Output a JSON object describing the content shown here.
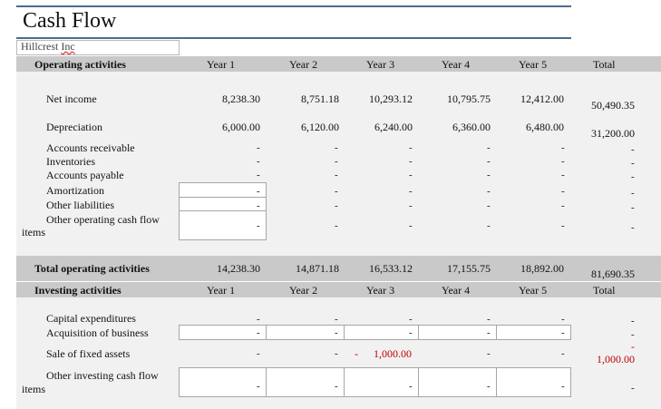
{
  "title": "Cash Flow",
  "company": {
    "prefix": "Hillcrest ",
    "underlined": "Inc"
  },
  "years": [
    "Year 1",
    "Year 2",
    "Year 3",
    "Year 4",
    "Year 5"
  ],
  "total_label": "Total",
  "operating": {
    "header": "Operating activities",
    "rows": [
      {
        "label": "Net income",
        "values": [
          "8,238.30",
          "8,751.18",
          "10,293.12",
          "10,795.75",
          "12,412.00"
        ],
        "total": "50,490.35"
      },
      {
        "label": "Depreciation",
        "values": [
          "6,000.00",
          "6,120.00",
          "6,240.00",
          "6,360.00",
          "6,480.00"
        ],
        "total": "31,200.00"
      },
      {
        "label": "Accounts receivable",
        "values": [
          "-",
          "-",
          "-",
          "-",
          "-"
        ],
        "total": "-"
      },
      {
        "label": "Inventories",
        "values": [
          "-",
          "-",
          "-",
          "-",
          "-"
        ],
        "total": "-"
      },
      {
        "label": "Accounts payable",
        "values": [
          "-",
          "-",
          "-",
          "-",
          "-"
        ],
        "total": "-"
      },
      {
        "label": "Amortization",
        "values": [
          "-",
          "-",
          "-",
          "-",
          "-"
        ],
        "total": "-"
      },
      {
        "label": "Other liabilities",
        "values": [
          "-",
          "-",
          "-",
          "-",
          "-"
        ],
        "total": "-"
      },
      {
        "label": "Other operating cash flow",
        "label2": "items",
        "values": [
          "-",
          "-",
          "-",
          "-",
          "-"
        ],
        "total": "-"
      }
    ],
    "total_label": "Total operating activities",
    "total_values": [
      "14,238.30",
      "14,871.18",
      "16,533.12",
      "17,155.75",
      "18,892.00"
    ],
    "total_total": "81,690.35"
  },
  "investing": {
    "header": "Investing activities",
    "rows": [
      {
        "label": "Capital expenditures",
        "values": [
          "-",
          "-",
          "-",
          "-",
          "-"
        ],
        "total": "-"
      },
      {
        "label": "Acquisition of business",
        "values": [
          "-",
          "-",
          "-",
          "-",
          "-"
        ],
        "total": "-"
      },
      {
        "label": "Sale of fixed assets",
        "values": [
          "-",
          "-",
          "1,000.00",
          "-",
          "-"
        ],
        "pre": "-",
        "total": "1,000.00",
        "total_pre": "-"
      },
      {
        "label": "Other investing cash flow",
        "label2": "items",
        "values": [
          "-",
          "-",
          "-",
          "-",
          "-"
        ],
        "total": "-"
      }
    ]
  },
  "colors": {
    "rule": "#4a6d8c",
    "header_band": "#c9c9c9",
    "body_band": "#f1f1f1",
    "negative_red": "#c00000"
  }
}
